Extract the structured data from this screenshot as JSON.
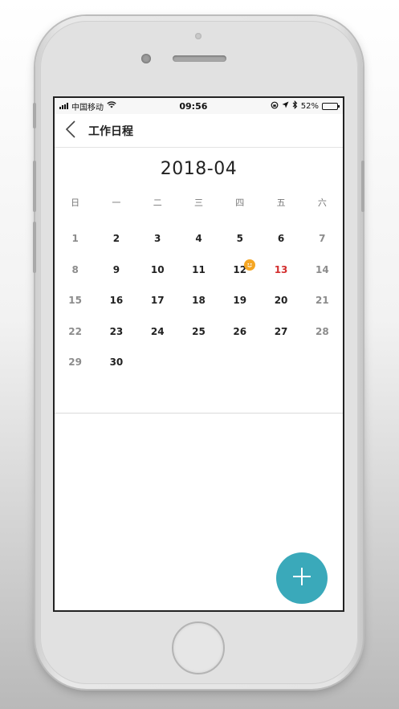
{
  "status_bar": {
    "carrier": "中国移动",
    "time": "09:56",
    "battery_text": "52%",
    "battery_level": 0.52
  },
  "nav": {
    "title": "工作日程",
    "back_icon": "chevron-left-icon"
  },
  "calendar": {
    "month_label": "2018-04",
    "weekdays": [
      "日",
      "一",
      "二",
      "三",
      "四",
      "五",
      "六"
    ],
    "leading_blanks": 0,
    "days": [
      "1",
      "2",
      "3",
      "4",
      "5",
      "6",
      "7",
      "8",
      "9",
      "10",
      "11",
      "12",
      "13",
      "14",
      "15",
      "16",
      "17",
      "18",
      "19",
      "20",
      "21",
      "22",
      "23",
      "24",
      "25",
      "26",
      "27",
      "28",
      "29",
      "30"
    ],
    "today": "13",
    "event_day": "12",
    "event_badge_icon": "smiley-face-icon"
  },
  "fab": {
    "icon": "plus-icon"
  },
  "colors": {
    "accent": "#3aa9ba",
    "today": "#d32f2f",
    "badge": "#f5a623",
    "weekend": "#8c8c8c"
  }
}
